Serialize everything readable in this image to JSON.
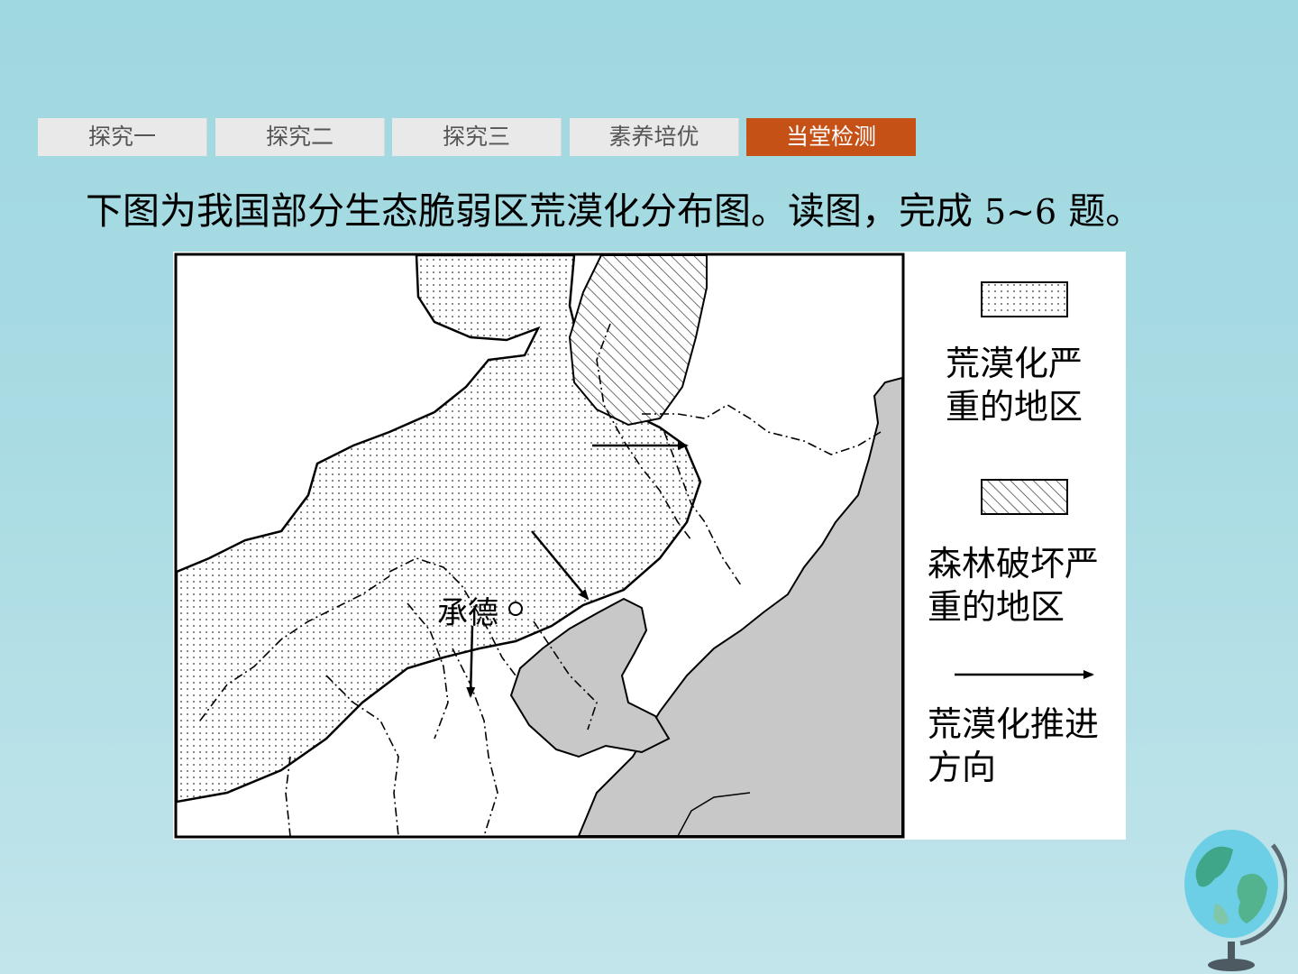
{
  "nav": {
    "tabs": [
      {
        "label": "探究一",
        "active": false
      },
      {
        "label": "探究二",
        "active": false
      },
      {
        "label": "探究三",
        "active": false
      },
      {
        "label": "素养培优",
        "active": false
      },
      {
        "label": "当堂检测",
        "active": true
      }
    ],
    "active_color": "#c65117"
  },
  "question": {
    "prefix": "下图为我国部分生态脆弱区荒漠化分布图。读图，完成 ",
    "range": "5~6",
    "suffix": " 题。"
  },
  "map": {
    "city_label": "承德",
    "sea_color": "#c8c8c8",
    "legend": [
      {
        "label": "荒漠化严\n重的地区",
        "pattern": "dots"
      },
      {
        "label": "森林破坏严\n重的地区",
        "pattern": "hatch"
      },
      {
        "label": "荒漠化推进\n方向",
        "pattern": "arrow"
      }
    ]
  },
  "decoration": {
    "icon": "globe-icon"
  }
}
